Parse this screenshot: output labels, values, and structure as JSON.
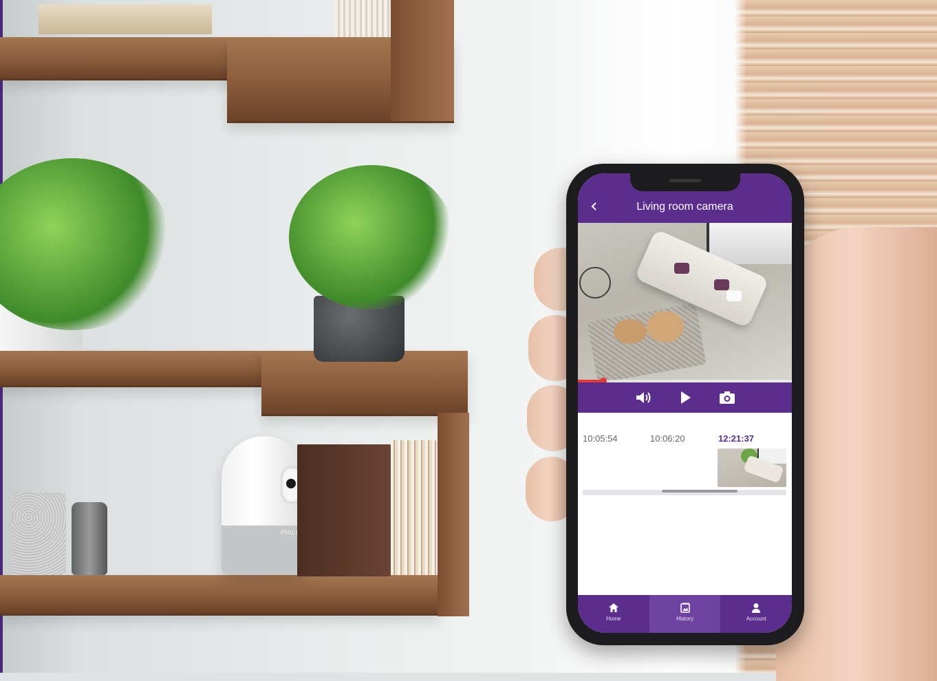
{
  "app": {
    "title": "Living room camera",
    "back_icon": "chevron-left-icon"
  },
  "camera_device": {
    "brand_label": "PHILIPS"
  },
  "player": {
    "progress": 0.12,
    "controls": [
      {
        "name": "volume-icon"
      },
      {
        "name": "play-icon"
      },
      {
        "name": "camera-snapshot-icon"
      }
    ]
  },
  "timeline": {
    "events": [
      {
        "time": "10:05:54",
        "active": false
      },
      {
        "time": "10:06:20",
        "active": false
      },
      {
        "time": "12:21:37",
        "active": true
      }
    ],
    "scroll_position": 0.62
  },
  "tabs": [
    {
      "label": "Home",
      "icon": "home-icon",
      "active": false
    },
    {
      "label": "History",
      "icon": "history-icon",
      "active": true
    },
    {
      "label": "Account",
      "icon": "account-icon",
      "active": false
    }
  ],
  "colors": {
    "accent": "#5b2e8e",
    "progress": "#e53935"
  }
}
